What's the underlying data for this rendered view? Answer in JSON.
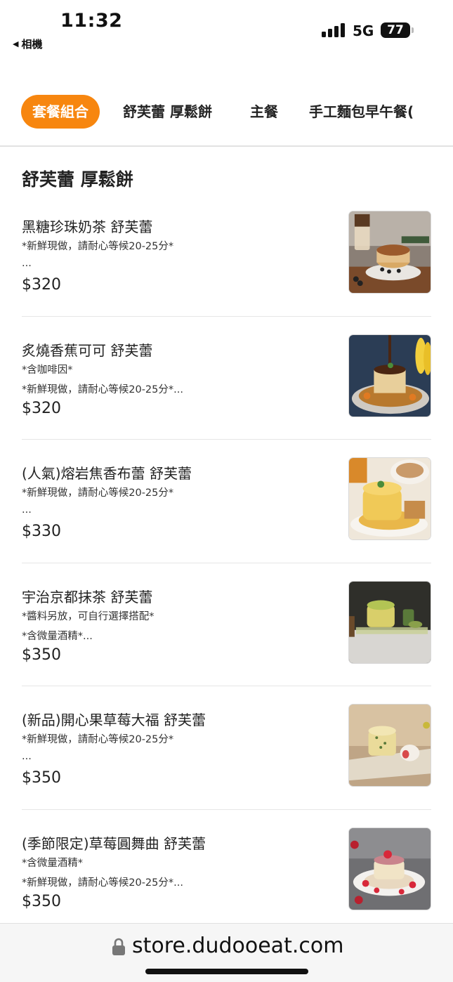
{
  "status_bar": {
    "time": "11:32",
    "back_app": "相機",
    "network": "5G",
    "battery": "77"
  },
  "tabs": [
    {
      "label": "套餐組合",
      "active": true
    },
    {
      "label": "舒芙蕾 厚鬆餅",
      "active": false
    },
    {
      "label": "主餐",
      "active": false
    },
    {
      "label": "手工麵包早午餐(",
      "active": false
    }
  ],
  "section": {
    "title": "舒芙蕾 厚鬆餅"
  },
  "items": [
    {
      "name": "黑糖珍珠奶茶 舒芙蕾",
      "desc1": "*新鮮現做，請耐心等候20-25分*",
      "desc2": "...",
      "price": "$320"
    },
    {
      "name": "炙燒香蕉可可 舒芙蕾",
      "desc1": "*含咖啡因*",
      "desc2": "*新鮮現做，請耐心等候20-25分*...",
      "price": "$320"
    },
    {
      "name": "(人氣)熔岩焦香布蕾 舒芙蕾",
      "desc1": "*新鮮現做，請耐心等候20-25分*",
      "desc2": "...",
      "price": "$330"
    },
    {
      "name": "宇治京都抹茶 舒芙蕾",
      "desc1": "*醬料另放，可自行選擇搭配*",
      "desc2": "*含微量酒精*...",
      "price": "$350"
    },
    {
      "name": "(新品)開心果草莓大福 舒芙蕾",
      "desc1": "*新鮮現做，請耐心等候20-25分*",
      "desc2": "...",
      "price": "$350"
    },
    {
      "name": "(季節限定)草莓圓舞曲 舒芙蕾",
      "desc1": "*含微量酒精*",
      "desc2": "*新鮮現做，請耐心等候20-25分*...",
      "price": "$350"
    }
  ],
  "url_bar": {
    "url": "store.dudooeat.com",
    "icon": "lock-icon"
  },
  "colors": {
    "accent": "#f7860f",
    "text": "#222222",
    "divider": "#e6e6e6"
  }
}
